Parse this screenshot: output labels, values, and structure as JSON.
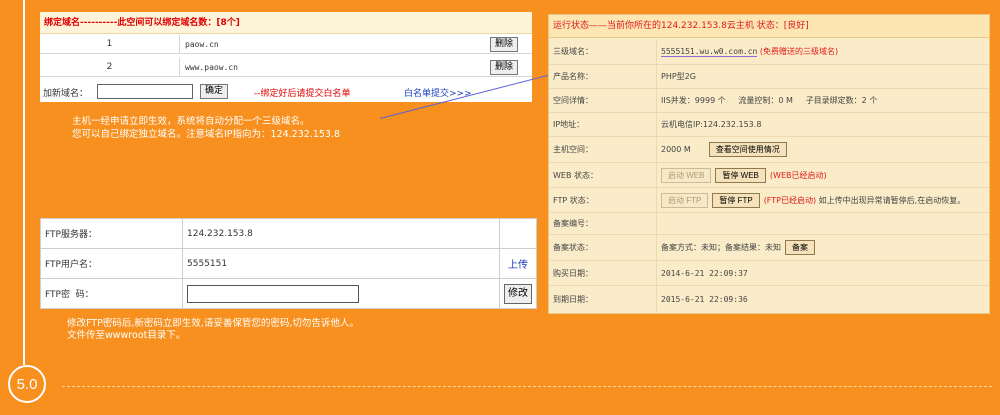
{
  "step_number": "5.0",
  "domain_panel": {
    "header": "绑定域名----------此空间可以绑定域名数：[8个]",
    "rows": [
      {
        "num": "1",
        "domain": "paow.cn",
        "btn": "删除"
      },
      {
        "num": "2",
        "domain": "www.paow.cn",
        "btn": "删除"
      }
    ],
    "add_label": "加新域名：",
    "add_value": "",
    "ok_btn": "确定",
    "warning": "--绑定好后请提交白名单",
    "whitelist_link": "白名单提交>>>"
  },
  "note1": {
    "line1": "主机一经申请立即生效，系统将自动分配一个三级域名。",
    "line2": "您可以自己绑定独立域名。注意域名IP指向为：124.232.153.8"
  },
  "ftp": {
    "server_label": "FTP服务器：",
    "server_value": "124.232.153.8",
    "user_label": "FTP用户名：",
    "user_value": "5555151",
    "upload_link": "上传",
    "pw_label": "FTP密  码：",
    "pw_value": "",
    "edit_btn": "修改"
  },
  "note2": {
    "line1": "修改FTP密码后,新密码立即生效,请妥善保管您的密码,切勿告诉他人。",
    "line2": "文件传至wwwroot目录下。"
  },
  "status_panel": {
    "header": "运行状态——当前你所在的124.232.153.8云主机  状态：[良好]",
    "rows": {
      "subdomain": {
        "label": "三级域名：",
        "value": "5555151.wu.w0.com.cn",
        "note": "(免费赠送的三级域名)"
      },
      "product": {
        "label": "产品名称：",
        "value": "PHP型2G"
      },
      "space": {
        "label": "空间详情：",
        "iis": "IIS并发：9999 个",
        "flow": "流量控制：0 M",
        "sub": "子目录绑定数：2 个"
      },
      "ip": {
        "label": "IP地址：",
        "value": "云机电信IP:124.232.153.8"
      },
      "host_space": {
        "label": "主机空间：",
        "value": "2000 M",
        "btn": "查看空间使用情况"
      },
      "web": {
        "label": "WEB 状态：",
        "start_btn": "启动 WEB",
        "pause_btn": "暂停 WEB",
        "status": "(WEB已经启动)"
      },
      "ftp": {
        "label": "FTP 状态：",
        "start_btn": "启动 FTP",
        "pause_btn": "暂停 FTP",
        "status": "(FTP已经启动)",
        "tip": "如上传中出现异常请暂停后,在启动恢复。"
      },
      "record_no": {
        "label": "备案编号：",
        "value": ""
      },
      "record_status": {
        "label": "备案状态：",
        "value": "备案方式：未知；备案结果：未知",
        "btn": "备案"
      },
      "buy_date": {
        "label": "购买日期：",
        "value": "2014-6-21 22:09:37"
      },
      "expire_date": {
        "label": "到期日期：",
        "value": "2015-6-21 22:09:36"
      }
    }
  }
}
